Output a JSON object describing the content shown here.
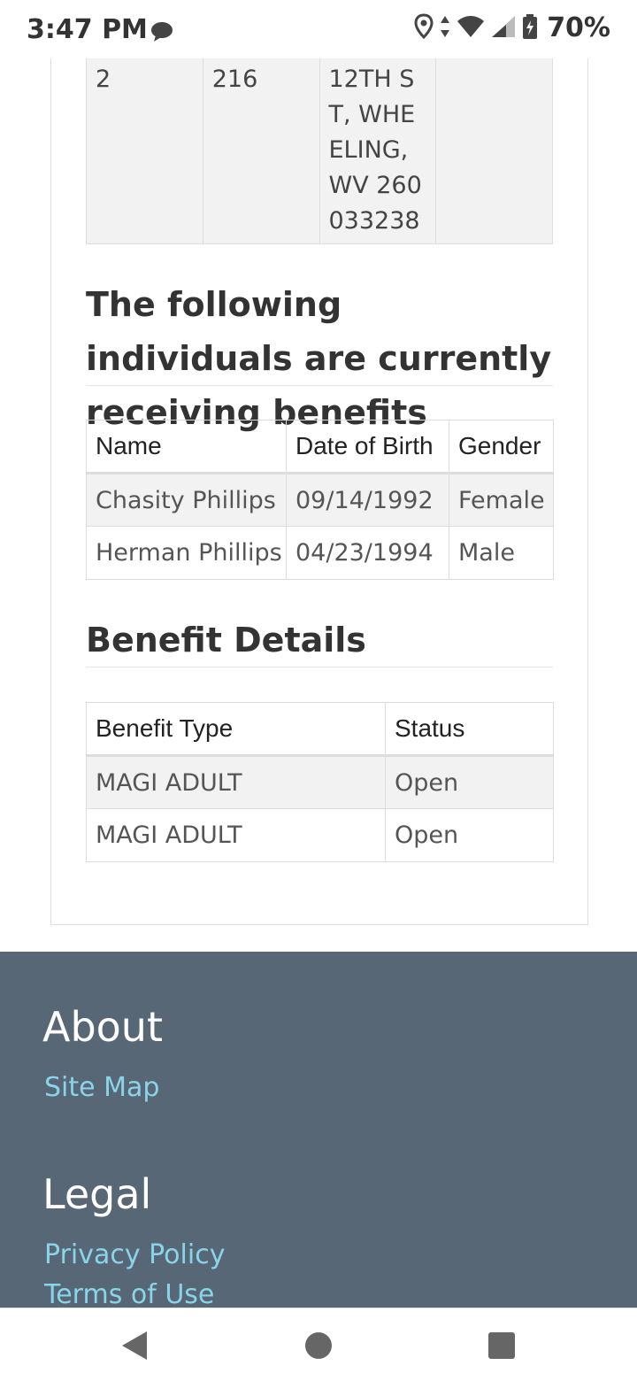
{
  "status_bar": {
    "time": "3:47 PM",
    "battery_percent": "70%",
    "icons": [
      "message-icon",
      "location-icon",
      "data-arrows-icon",
      "wifi-icon",
      "signal-icon",
      "battery-charging-icon"
    ]
  },
  "address_table": {
    "cells": [
      "2",
      "216",
      "12TH ST, WHEELING, WV 260033238",
      ""
    ]
  },
  "individuals": {
    "heading": "The following individuals are currently receiving benefits",
    "columns": [
      "Name",
      "Date of Birth",
      "Gender"
    ],
    "rows": [
      [
        "Chasity Phillips",
        "09/14/1992",
        "Female"
      ],
      [
        "Herman Phillips",
        "04/23/1994",
        "Male"
      ]
    ]
  },
  "benefits": {
    "heading": "Benefit Details",
    "columns": [
      "Benefit Type",
      "Status"
    ],
    "rows": [
      [
        "MAGI ADULT",
        "Open"
      ],
      [
        "MAGI ADULT",
        "Open"
      ]
    ]
  },
  "footer": {
    "about_heading": "About",
    "site_map": "Site Map",
    "legal_heading": "Legal",
    "privacy_policy": "Privacy Policy",
    "terms_of_use": "Terms of Use"
  },
  "colors": {
    "footer_bg": "#576776",
    "footer_link": "#8ad4ea",
    "stripe": "#f2f2f2"
  },
  "navbar": {
    "icons": [
      "back-icon",
      "home-icon",
      "recents-icon"
    ]
  }
}
